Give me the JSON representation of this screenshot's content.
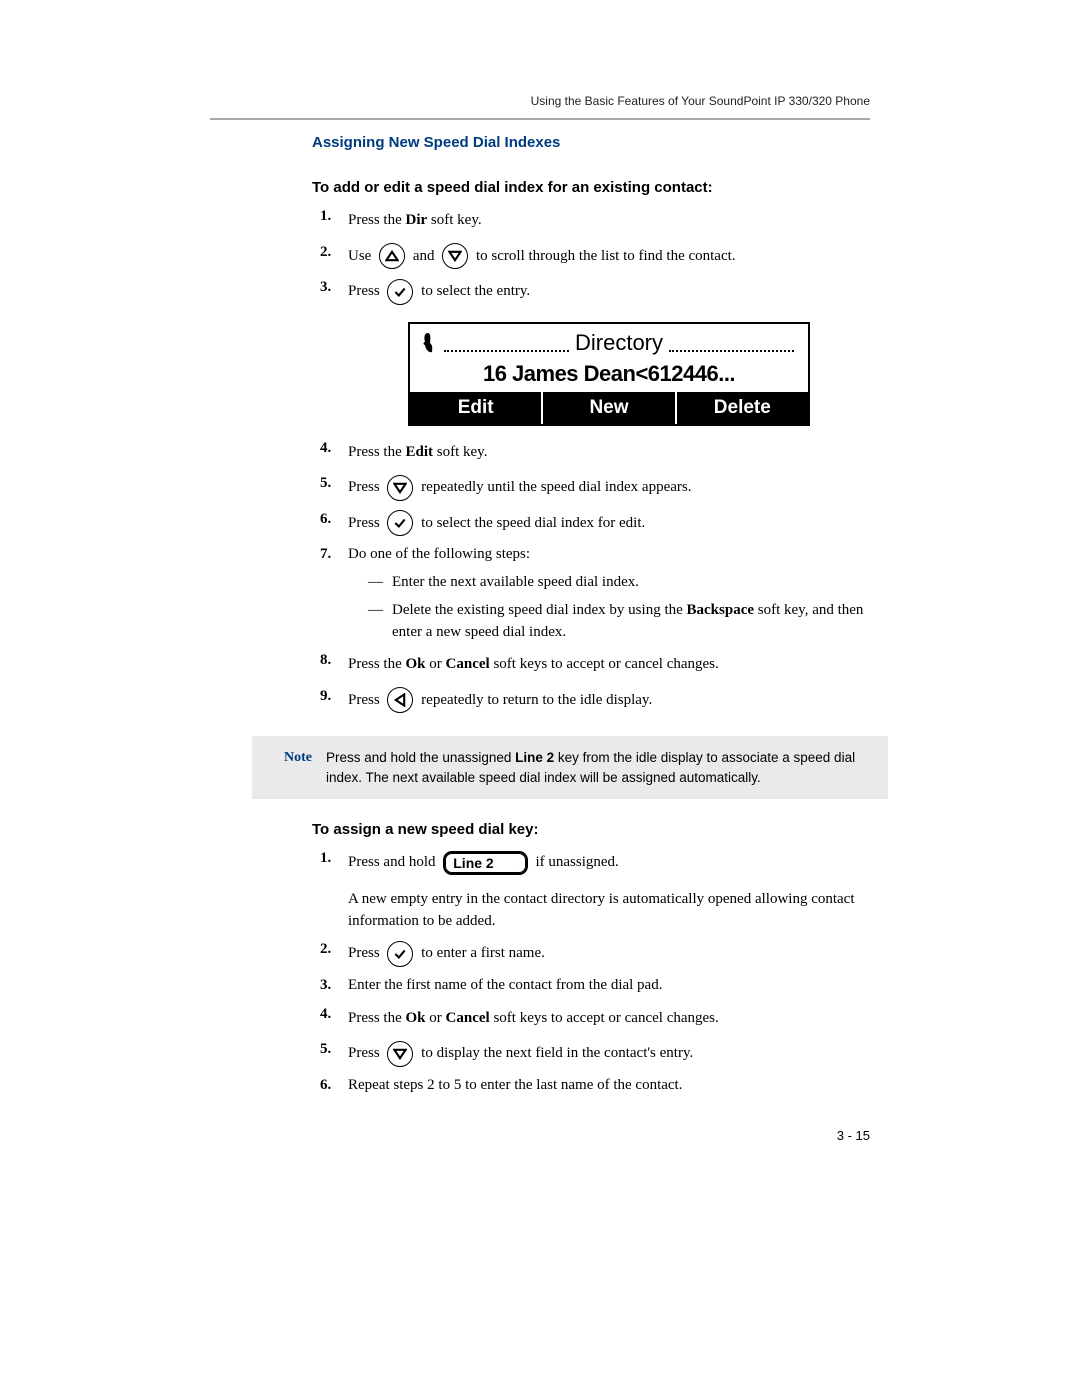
{
  "runningHead": "Using the Basic Features of Your SoundPoint IP 330/320 Phone",
  "sectionTitle": "Assigning New Speed Dial Indexes",
  "procTitle1": "To add or edit a speed dial index for an existing contact:",
  "steps1": {
    "s1": {
      "num": "1.",
      "pre": "Press the ",
      "b": "Dir",
      "post": " soft key."
    },
    "s2": {
      "num": "2.",
      "a": "Use ",
      "b": " and ",
      "c": " to scroll through the list to find the contact."
    },
    "s3": {
      "num": "3.",
      "a": "Press ",
      "b": " to select the entry."
    },
    "s4": {
      "num": "4.",
      "pre": "Press the ",
      "b": "Edit",
      "post": " soft key."
    },
    "s5": {
      "num": "5.",
      "a": "Press ",
      "b": " repeatedly until the speed dial index appears."
    },
    "s6": {
      "num": "6.",
      "a": "Press ",
      "b": " to select the speed dial index for edit."
    },
    "s7": {
      "num": "7.",
      "text": "Do one of the following steps:",
      "sub1": "Enter the next available speed dial index.",
      "sub2a": "Delete the existing speed dial index by using the ",
      "sub2b": "Backspace",
      "sub2c": " soft key, and then enter a new speed dial index."
    },
    "s8": {
      "num": "8.",
      "a": "Press the ",
      "b1": "Ok",
      "c": " or ",
      "b2": "Cancel",
      "d": " soft keys to accept or cancel changes."
    },
    "s9": {
      "num": "9.",
      "a": "Press ",
      "b": " repeatedly to return to the idle display."
    }
  },
  "screen": {
    "header": "Directory",
    "row": "16 James Dean<612446...",
    "sk1": "Edit",
    "sk2": "New",
    "sk3": "Delete"
  },
  "note": {
    "label": "Note",
    "t1": "Press and hold the unassigned ",
    "b": "Line 2",
    "t2": " key from the idle display to associate a speed dial index. The next available speed dial index will be assigned automatically."
  },
  "procTitle2": "To assign a new speed dial key:",
  "steps2": {
    "s1": {
      "num": "1.",
      "a": "Press and hold ",
      "key": "Line 2",
      "b": " if unassigned.",
      "para": "A new empty entry in the contact directory is automatically opened allowing contact information to be added."
    },
    "s2": {
      "num": "2.",
      "a": "Press ",
      "b": " to enter a first name."
    },
    "s3": {
      "num": "3.",
      "text": "Enter the first name of the contact from the dial pad."
    },
    "s4": {
      "num": "4.",
      "a": "Press the ",
      "b1": "Ok",
      "c": " or ",
      "b2": "Cancel",
      "d": " soft keys to accept or cancel changes."
    },
    "s5": {
      "num": "5.",
      "a": "Press ",
      "b": " to display the next field in the contact's entry."
    },
    "s6": {
      "num": "6.",
      "text": "Repeat steps 2 to 5 to enter the last name of the contact."
    }
  },
  "pageNum": "3 - 15"
}
